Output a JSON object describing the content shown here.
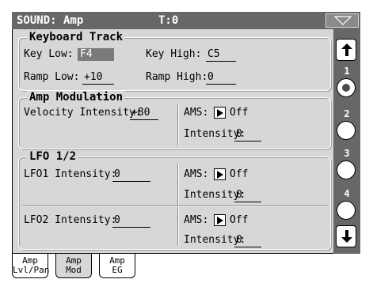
{
  "header": {
    "title": "SOUND: Amp",
    "track": "T:0"
  },
  "keyboard_track": {
    "title": "Keyboard Track",
    "key_low_label": "Key Low:",
    "key_low_value": "F4",
    "key_high_label": "Key High:",
    "key_high_value": "C5",
    "ramp_low_label": "Ramp Low:",
    "ramp_low_value": "+10",
    "ramp_high_label": "Ramp High:",
    "ramp_high_value": "0"
  },
  "amp_modulation": {
    "title": "Amp Modulation",
    "velocity_label": "Velocity Intensity:",
    "velocity_value": "+80",
    "ams_label": "AMS:",
    "ams_value": "Off",
    "intensity_label": "Intensity:",
    "intensity_value": "0"
  },
  "lfo": {
    "title": "LFO 1/2",
    "lfo1_label": "LFO1 Intensity:",
    "lfo1_value": "0",
    "lfo1_ams_label": "AMS:",
    "lfo1_ams_value": "Off",
    "lfo1_intensity_label": "Intensity:",
    "lfo1_intensity_value": "0",
    "lfo2_label": "LFO2 Intensity:",
    "lfo2_value": "0",
    "lfo2_ams_label": "AMS:",
    "lfo2_ams_value": "Off",
    "lfo2_intensity_label": "Intensity:",
    "lfo2_intensity_value": "0"
  },
  "pages": [
    "1",
    "2",
    "3",
    "4"
  ],
  "active_page": "1",
  "tabs": [
    {
      "line1": "Amp",
      "line2": "Lvl/Pan"
    },
    {
      "line1": "Amp",
      "line2": "Mod"
    },
    {
      "line1": "Amp",
      "line2": "EG"
    }
  ],
  "active_tab": 1,
  "colors": {
    "panel": "#d7d7d7",
    "titlebar": "#676767",
    "selected_field": "#7a7a7a"
  },
  "icons": {
    "menu": "triangle-down-icon",
    "scroll_up": "arrow-up-icon",
    "scroll_down": "arrow-down-icon",
    "ams": "triangle-right-icon"
  }
}
